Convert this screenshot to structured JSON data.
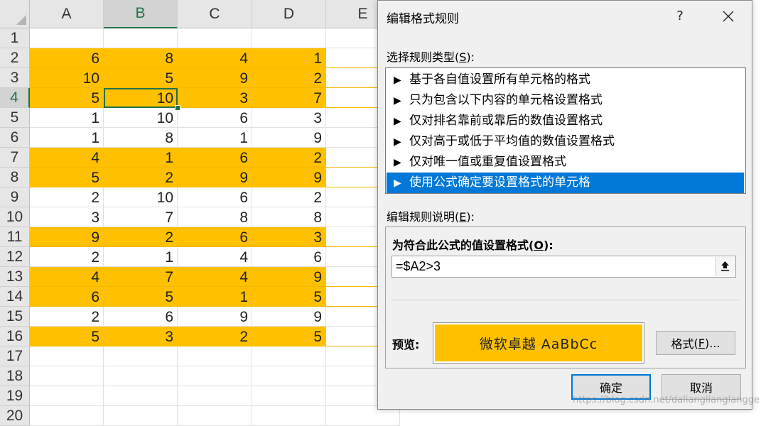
{
  "sheet": {
    "columns": [
      "A",
      "B",
      "C",
      "D",
      "E"
    ],
    "selected_column": "B",
    "selected_row": 4,
    "highlight_color": "#ffc000",
    "rows": [
      {
        "num": "1",
        "values": [
          "",
          "",
          "",
          ""
        ],
        "highlighted": false
      },
      {
        "num": "2",
        "values": [
          "6",
          "8",
          "4",
          "1"
        ],
        "highlighted": true
      },
      {
        "num": "3",
        "values": [
          "10",
          "5",
          "9",
          "2"
        ],
        "highlighted": true
      },
      {
        "num": "4",
        "values": [
          "5",
          "10",
          "3",
          "7"
        ],
        "highlighted": true
      },
      {
        "num": "5",
        "values": [
          "1",
          "10",
          "6",
          "3"
        ],
        "highlighted": false
      },
      {
        "num": "6",
        "values": [
          "1",
          "8",
          "1",
          "9"
        ],
        "highlighted": false
      },
      {
        "num": "7",
        "values": [
          "4",
          "1",
          "6",
          "2"
        ],
        "highlighted": true
      },
      {
        "num": "8",
        "values": [
          "5",
          "2",
          "9",
          "9"
        ],
        "highlighted": true
      },
      {
        "num": "9",
        "values": [
          "2",
          "10",
          "6",
          "2"
        ],
        "highlighted": false
      },
      {
        "num": "10",
        "values": [
          "3",
          "7",
          "8",
          "8"
        ],
        "highlighted": false
      },
      {
        "num": "11",
        "values": [
          "9",
          "2",
          "6",
          "3"
        ],
        "highlighted": true
      },
      {
        "num": "12",
        "values": [
          "2",
          "1",
          "4",
          "6"
        ],
        "highlighted": false
      },
      {
        "num": "13",
        "values": [
          "4",
          "7",
          "4",
          "9"
        ],
        "highlighted": true
      },
      {
        "num": "14",
        "values": [
          "6",
          "5",
          "1",
          "5"
        ],
        "highlighted": true
      },
      {
        "num": "15",
        "values": [
          "2",
          "6",
          "9",
          "9"
        ],
        "highlighted": false
      },
      {
        "num": "16",
        "values": [
          "5",
          "3",
          "2",
          "5"
        ],
        "highlighted": true
      },
      {
        "num": "17",
        "values": [
          "",
          "",
          "",
          ""
        ],
        "highlighted": false
      },
      {
        "num": "18",
        "values": [
          "",
          "",
          "",
          ""
        ],
        "highlighted": false
      },
      {
        "num": "19",
        "values": [
          "",
          "",
          "",
          ""
        ],
        "highlighted": false
      },
      {
        "num": "20",
        "values": [
          "",
          "",
          "",
          ""
        ],
        "highlighted": false
      }
    ]
  },
  "dialog": {
    "title": "编辑格式规则",
    "help_label": "?",
    "close_icon": "close-icon",
    "rule_type_label": "选择规则类型",
    "rule_type_key": "(S)",
    "rule_type_key_letter": "S",
    "rule_types": [
      {
        "label": "基于各自值设置所有单元格的格式",
        "selected": false
      },
      {
        "label": "只为包含以下内容的单元格设置格式",
        "selected": false
      },
      {
        "label": "仅对排名靠前或靠后的数值设置格式",
        "selected": false
      },
      {
        "label": "仅对高于或低于平均值的数值设置格式",
        "selected": false
      },
      {
        "label": "仅对唯一值或重复值设置格式",
        "selected": false
      },
      {
        "label": "使用公式确定要设置格式的单元格",
        "selected": true
      }
    ],
    "rule_type_arrow": "▶",
    "description_label": "编辑规则说明",
    "description_key_letter": "E",
    "formula_heading": "为符合此公式的值设置格式",
    "formula_heading_key_letter": "O",
    "formula_value": "=$A2>3",
    "preview_label": "预览:",
    "preview_text": "微软卓越  AaBbCc",
    "preview_color": "#ffc000",
    "format_button": "格式",
    "format_button_key_letter": "F",
    "ok_button": "确定",
    "cancel_button": "取消"
  },
  "watermark": "https://blog.csdn.net/dalianglianglangge"
}
